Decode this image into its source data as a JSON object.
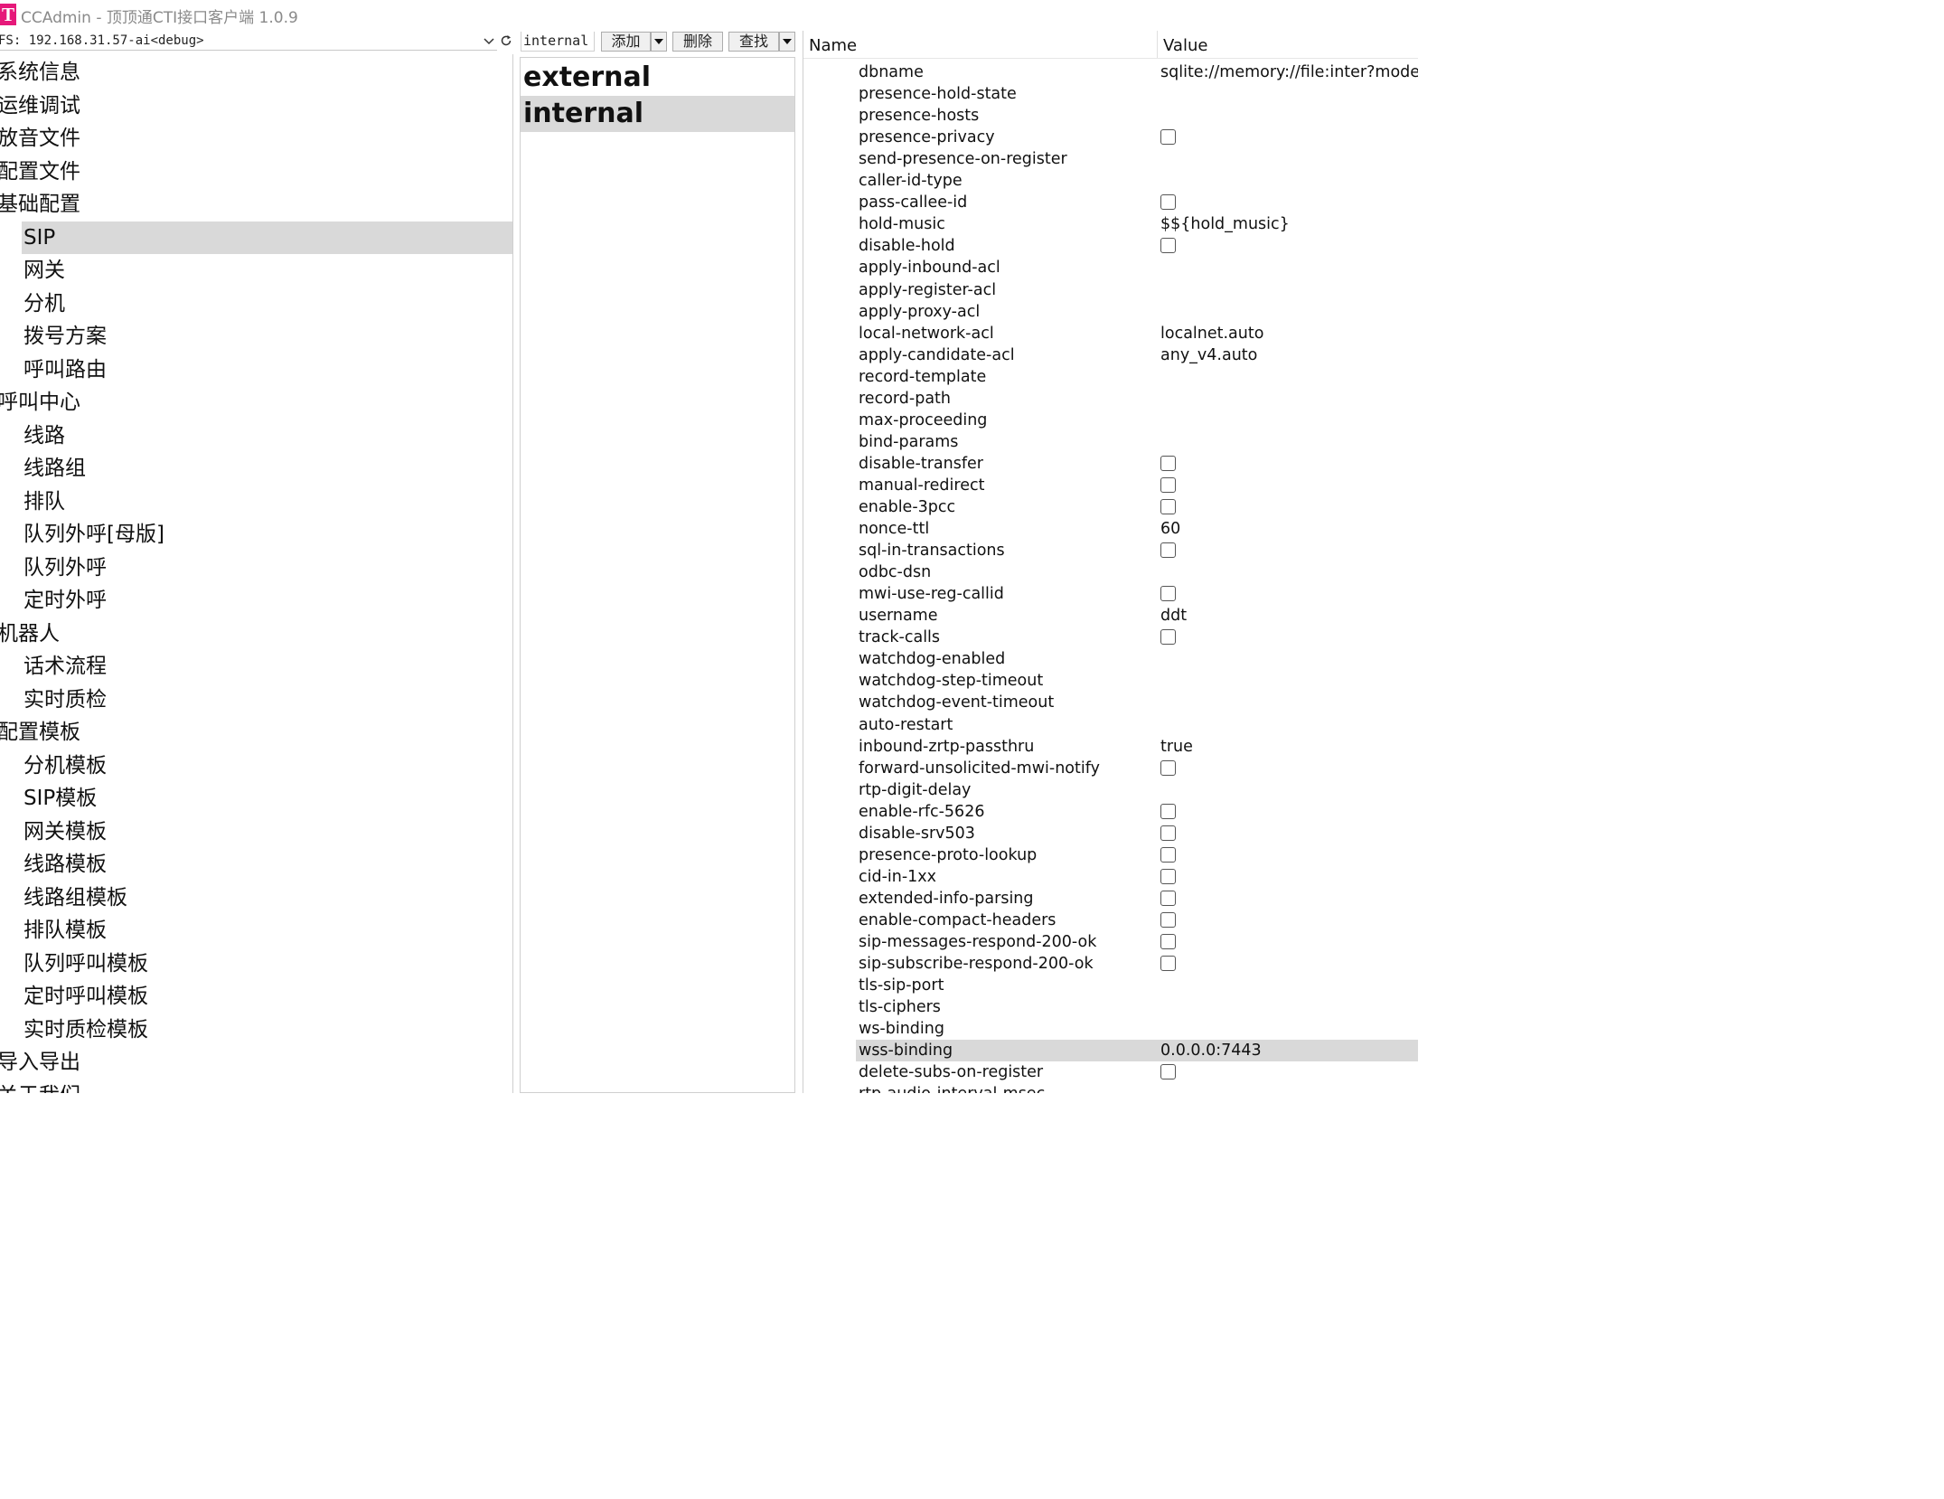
{
  "window": {
    "title": "CCAdmin - 顶顶通CTI接口客户端 1.0.9",
    "logo_letter": "T"
  },
  "server": {
    "value": "FS: 192.168.31.57-ai<debug>"
  },
  "tree": [
    {
      "label": "系统信息",
      "level": 0
    },
    {
      "label": "运维调试",
      "level": 0
    },
    {
      "label": "放音文件",
      "level": 0
    },
    {
      "label": "配置文件",
      "level": 0
    },
    {
      "label": "基础配置",
      "level": 0
    },
    {
      "label": "SIP",
      "level": 1,
      "selected": true
    },
    {
      "label": "网关",
      "level": 1
    },
    {
      "label": "分机",
      "level": 1
    },
    {
      "label": "拨号方案",
      "level": 1
    },
    {
      "label": "呼叫路由",
      "level": 1
    },
    {
      "label": "呼叫中心",
      "level": 0
    },
    {
      "label": "线路",
      "level": 1
    },
    {
      "label": "线路组",
      "level": 1
    },
    {
      "label": "排队",
      "level": 1
    },
    {
      "label": "队列外呼[母版]",
      "level": 1
    },
    {
      "label": "队列外呼",
      "level": 1
    },
    {
      "label": "定时外呼",
      "level": 1
    },
    {
      "label": "机器人",
      "level": 0
    },
    {
      "label": "话术流程",
      "level": 1
    },
    {
      "label": "实时质检",
      "level": 1
    },
    {
      "label": "配置模板",
      "level": 0
    },
    {
      "label": "分机模板",
      "level": 1
    },
    {
      "label": "SIP模板",
      "level": 1
    },
    {
      "label": "网关模板",
      "level": 1
    },
    {
      "label": "线路模板",
      "level": 1
    },
    {
      "label": "线路组模板",
      "level": 1
    },
    {
      "label": "排队模板",
      "level": 1
    },
    {
      "label": "队列呼叫模板",
      "level": 1
    },
    {
      "label": "定时呼叫模板",
      "level": 1
    },
    {
      "label": "实时质检模板",
      "level": 1
    },
    {
      "label": "导入导出",
      "level": 0
    },
    {
      "label": "关于我们",
      "level": 0
    }
  ],
  "toolbar": {
    "profile_value": "internal",
    "add_label": "添加",
    "delete_label": "删除",
    "find_label": "查找"
  },
  "profiles": [
    {
      "label": "external",
      "selected": false
    },
    {
      "label": "internal",
      "selected": true
    }
  ],
  "grid": {
    "name_header": "Name",
    "value_header": "Value",
    "rows": [
      {
        "name": "dbname",
        "value": "sqlite://memory://file:inter?mode=memory&cache=shared"
      },
      {
        "name": "presence-hold-state",
        "value": ""
      },
      {
        "name": "presence-hosts",
        "value": ""
      },
      {
        "name": "presence-privacy",
        "checkbox": true,
        "checked": false
      },
      {
        "name": "send-presence-on-register",
        "value": ""
      },
      {
        "name": "caller-id-type",
        "value": ""
      },
      {
        "name": "pass-callee-id",
        "checkbox": true,
        "checked": false
      },
      {
        "name": "hold-music",
        "value": "$${hold_music}"
      },
      {
        "name": "disable-hold",
        "checkbox": true,
        "checked": false
      },
      {
        "name": "apply-inbound-acl",
        "value": ""
      },
      {
        "name": "apply-register-acl",
        "value": ""
      },
      {
        "name": "apply-proxy-acl",
        "value": ""
      },
      {
        "name": "local-network-acl",
        "value": "localnet.auto"
      },
      {
        "name": "apply-candidate-acl",
        "value": "any_v4.auto"
      },
      {
        "name": "record-template",
        "value": ""
      },
      {
        "name": "record-path",
        "value": ""
      },
      {
        "name": "max-proceeding",
        "value": ""
      },
      {
        "name": "bind-params",
        "value": ""
      },
      {
        "name": "disable-transfer",
        "checkbox": true,
        "checked": false
      },
      {
        "name": "manual-redirect",
        "checkbox": true,
        "checked": false
      },
      {
        "name": "enable-3pcc",
        "checkbox": true,
        "checked": false
      },
      {
        "name": "nonce-ttl",
        "value": "60"
      },
      {
        "name": "sql-in-transactions",
        "checkbox": true,
        "checked": false
      },
      {
        "name": "odbc-dsn",
        "value": ""
      },
      {
        "name": "mwi-use-reg-callid",
        "checkbox": true,
        "checked": false
      },
      {
        "name": "username",
        "value": "ddt"
      },
      {
        "name": "track-calls",
        "checkbox": true,
        "checked": false
      },
      {
        "name": "watchdog-enabled",
        "value": ""
      },
      {
        "name": "watchdog-step-timeout",
        "value": ""
      },
      {
        "name": "watchdog-event-timeout",
        "value": ""
      },
      {
        "name": "auto-restart",
        "value": ""
      },
      {
        "name": "inbound-zrtp-passthru",
        "value": "true"
      },
      {
        "name": "forward-unsolicited-mwi-notify",
        "checkbox": true,
        "checked": false
      },
      {
        "name": "rtp-digit-delay",
        "value": ""
      },
      {
        "name": "enable-rfc-5626",
        "checkbox": true,
        "checked": false
      },
      {
        "name": "disable-srv503",
        "checkbox": true,
        "checked": false
      },
      {
        "name": "presence-proto-lookup",
        "checkbox": true,
        "checked": false
      },
      {
        "name": "cid-in-1xx",
        "checkbox": true,
        "checked": false
      },
      {
        "name": "extended-info-parsing",
        "checkbox": true,
        "checked": false
      },
      {
        "name": "enable-compact-headers",
        "checkbox": true,
        "checked": false
      },
      {
        "name": "sip-messages-respond-200-ok",
        "checkbox": true,
        "checked": false
      },
      {
        "name": "sip-subscribe-respond-200-ok",
        "checkbox": true,
        "checked": false
      },
      {
        "name": "tls-sip-port",
        "value": ""
      },
      {
        "name": "tls-ciphers",
        "value": ""
      },
      {
        "name": "ws-binding",
        "value": ""
      },
      {
        "name": "wss-binding",
        "value": "0.0.0.0:7443",
        "selected": true
      },
      {
        "name": "delete-subs-on-register",
        "checkbox": true,
        "checked": false
      },
      {
        "name": "rtp-audio-interval-msec",
        "value": ""
      }
    ]
  }
}
